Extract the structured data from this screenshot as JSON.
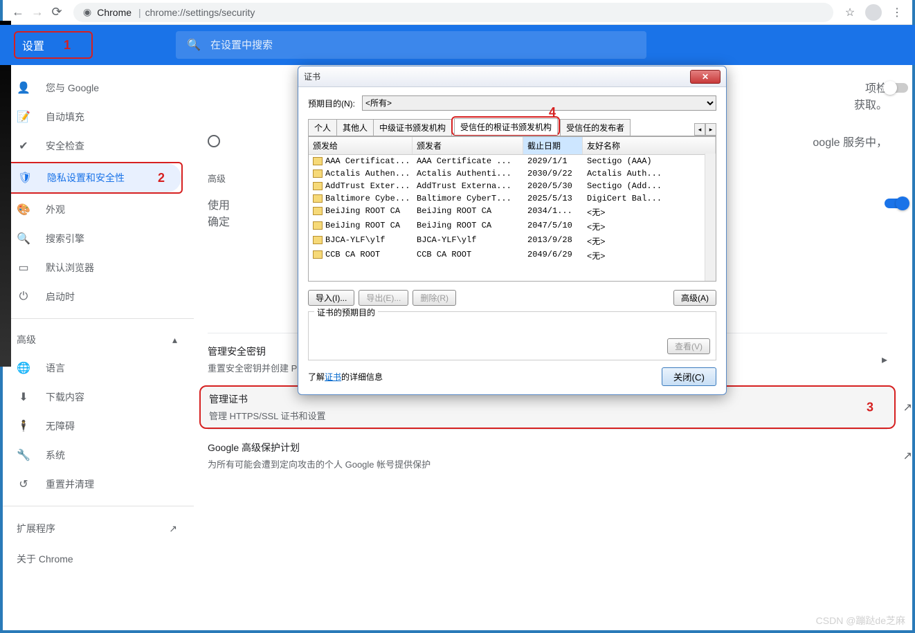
{
  "browser": {
    "url_origin": "Chrome",
    "url_path": "chrome://settings/security"
  },
  "header": {
    "title": "设置",
    "anno1": "1",
    "search_placeholder": "在设置中搜索"
  },
  "sidebar": {
    "items": [
      {
        "icon": "👤",
        "label": "您与 Google"
      },
      {
        "icon": "📝",
        "label": "自动填充"
      },
      {
        "icon": "✔",
        "label": "安全检查"
      },
      {
        "icon": "🛡",
        "label": "隐私设置和安全性",
        "selected": true,
        "anno": "2"
      },
      {
        "icon": "🎨",
        "label": "外观"
      },
      {
        "icon": "🔍",
        "label": "搜索引擎"
      },
      {
        "icon": "▭",
        "label": "默认浏览器"
      },
      {
        "icon": "⏻",
        "label": "启动时"
      }
    ],
    "advanced": "高级",
    "adv_items": [
      {
        "icon": "🌐",
        "label": "语言"
      },
      {
        "icon": "⬇",
        "label": "下载内容"
      },
      {
        "icon": "🕴",
        "label": "无障碍"
      },
      {
        "icon": "🔧",
        "label": "系统"
      },
      {
        "icon": "↺",
        "label": "重置并清理"
      }
    ],
    "extensions": "扩展程序",
    "about": "关于 Chrome"
  },
  "main": {
    "frag1": "项检",
    "frag2": "获取。",
    "frag3": "oogle 服务中，",
    "section_advanced": "高级",
    "frag4a": "使用",
    "frag4b": "确定",
    "row_keys_title": "管理安全密钥",
    "row_keys_sub": "重置安全密钥并创建 PIN 码",
    "row_certs_title": "管理证书",
    "row_certs_sub": "管理 HTTPS/SSL 证书和设置",
    "anno3": "3",
    "row_gap_title": "Google 高级保护计划",
    "row_gap_sub": "为所有可能会遭到定向攻击的个人 Google 帐号提供保护"
  },
  "dialog": {
    "title": "证书",
    "purpose_label": "预期目的(N):",
    "purpose_value": "<所有>",
    "tabs": [
      "个人",
      "其他人",
      "中级证书颁发机构",
      "受信任的根证书颁发机构",
      "受信任的发布者"
    ],
    "active_tab": 3,
    "anno4": "4",
    "cols": {
      "c1": "颁发给",
      "c2": "颁发者",
      "c3": "截止日期",
      "c4": "友好名称"
    },
    "rows": [
      {
        "to": "AAA Certificat...",
        "by": "AAA Certificate ...",
        "exp": "2029/1/1",
        "fn": "Sectigo (AAA)"
      },
      {
        "to": "Actalis Authen...",
        "by": "Actalis Authenti...",
        "exp": "2030/9/22",
        "fn": "Actalis Auth..."
      },
      {
        "to": "AddTrust Exter...",
        "by": "AddTrust Externa...",
        "exp": "2020/5/30",
        "fn": "Sectigo (Add..."
      },
      {
        "to": "Baltimore Cybe...",
        "by": "Baltimore CyberT...",
        "exp": "2025/5/13",
        "fn": "DigiCert Bal..."
      },
      {
        "to": "BeiJing ROOT CA",
        "by": "BeiJing ROOT CA",
        "exp": "2034/1...",
        "fn": "<无>"
      },
      {
        "to": "BeiJing ROOT CA",
        "by": "BeiJing ROOT CA",
        "exp": "2047/5/10",
        "fn": "<无>"
      },
      {
        "to": "BJCA-YLF\\ylf",
        "by": "BJCA-YLF\\ylf",
        "exp": "2013/9/28",
        "fn": "<无>"
      },
      {
        "to": "CCB CA ROOT",
        "by": "CCB CA ROOT",
        "exp": "2049/6/29",
        "fn": "<无>"
      }
    ],
    "btn_import": "导入(I)...",
    "btn_export": "导出(E)...",
    "btn_delete": "删除(R)",
    "btn_advanced": "高级(A)",
    "purpose_box": "证书的预期目的",
    "btn_view": "查看(V)",
    "learn_pre": "了解",
    "learn_link": "证书",
    "learn_post": "的详细信息",
    "btn_close": "关闭(C)"
  },
  "watermark": "CSDN @蹦跶de芝麻"
}
